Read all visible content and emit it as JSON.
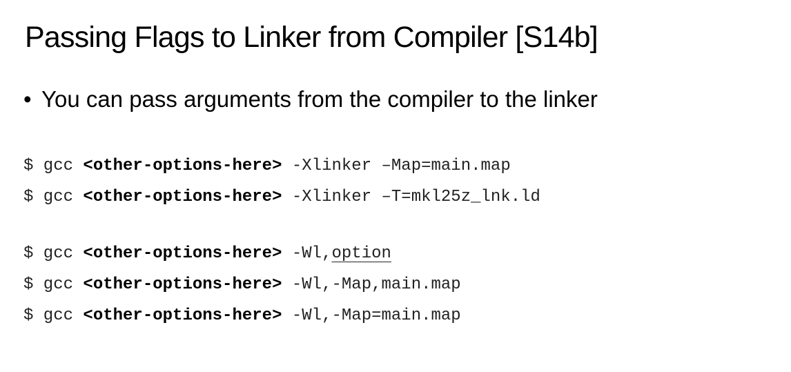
{
  "title": "Passing Flags to Linker from Compiler [S14b]",
  "bullet": {
    "symbol": "•",
    "text": "You can pass arguments from the compiler to the linker"
  },
  "code_lines": [
    {
      "prompt": "$ gcc ",
      "options": "<other-options-here>",
      "rest": " -Xlinker –Map=main.map"
    },
    {
      "prompt": "$ gcc ",
      "options": "<other-options-here>",
      "rest": " -Xlinker –T=mkl25z_lnk.ld"
    },
    {
      "prompt": "$ gcc ",
      "options": "<other-options-here>",
      "rest": " -Wl,",
      "underlined": "option"
    },
    {
      "prompt": "$ gcc ",
      "options": "<other-options-here>",
      "rest": " -Wl,-Map,main.map"
    },
    {
      "prompt": "$ gcc ",
      "options": "<other-options-here>",
      "rest": " -Wl,-Map=main.map"
    }
  ]
}
